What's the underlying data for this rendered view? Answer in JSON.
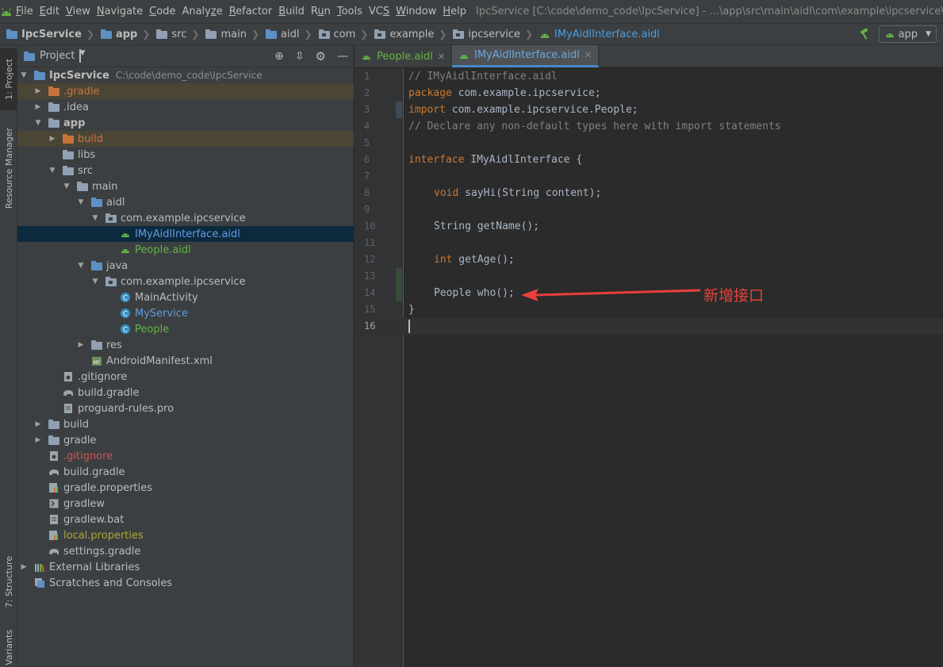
{
  "menu": {
    "items": [
      {
        "label": "File",
        "mnemonic": "F"
      },
      {
        "label": "Edit",
        "mnemonic": "E"
      },
      {
        "label": "View",
        "mnemonic": "V"
      },
      {
        "label": "Navigate",
        "mnemonic": "N"
      },
      {
        "label": "Code",
        "mnemonic": "C"
      },
      {
        "label": "Analyze",
        "mnemonic": "z"
      },
      {
        "label": "Refactor",
        "mnemonic": "R"
      },
      {
        "label": "Build",
        "mnemonic": "B"
      },
      {
        "label": "Run",
        "mnemonic": "u"
      },
      {
        "label": "Tools",
        "mnemonic": "T"
      },
      {
        "label": "VCS",
        "mnemonic": "S"
      },
      {
        "label": "Window",
        "mnemonic": "W"
      },
      {
        "label": "Help",
        "mnemonic": "H"
      }
    ],
    "window_title": "IpcService [C:\\code\\demo_code\\IpcService] - ...\\app\\src\\main\\aidl\\com\\example\\ipcservice\\IMyAidlInterface.aidl"
  },
  "breadcrumb": {
    "items": [
      "IpcService",
      "app",
      "src",
      "main",
      "aidl",
      "com",
      "example",
      "ipcservice",
      "IMyAidlInterface.aidl"
    ]
  },
  "run_config": {
    "label": "app"
  },
  "side_tabs": {
    "project": "1: Project",
    "resource_manager": "Resource Manager",
    "structure": "7: Structure",
    "variants": "Variants"
  },
  "project_panel": {
    "title": "Project",
    "root_path": "C:\\code\\demo_code\\IpcService",
    "tree": [
      {
        "label": "IpcService",
        "bold": true
      },
      {
        "label": ".gradle"
      },
      {
        "label": ".idea"
      },
      {
        "label": "app",
        "bold": true
      },
      {
        "label": "build"
      },
      {
        "label": "libs"
      },
      {
        "label": "src"
      },
      {
        "label": "main"
      },
      {
        "label": "aidl"
      },
      {
        "label": "com.example.ipcservice"
      },
      {
        "label": "IMyAidlInterface.aidl"
      },
      {
        "label": "People.aidl"
      },
      {
        "label": "java"
      },
      {
        "label": "com.example.ipcservice"
      },
      {
        "label": "MainActivity"
      },
      {
        "label": "MyService"
      },
      {
        "label": "People"
      },
      {
        "label": "res"
      },
      {
        "label": "AndroidManifest.xml"
      },
      {
        "label": ".gitignore"
      },
      {
        "label": "build.gradle"
      },
      {
        "label": "proguard-rules.pro"
      },
      {
        "label": "build"
      },
      {
        "label": "gradle"
      },
      {
        "label": ".gitignore"
      },
      {
        "label": "build.gradle"
      },
      {
        "label": "gradle.properties"
      },
      {
        "label": "gradlew"
      },
      {
        "label": "gradlew.bat"
      },
      {
        "label": "local.properties"
      },
      {
        "label": "settings.gradle"
      },
      {
        "label": "External Libraries"
      },
      {
        "label": "Scratches and Consoles"
      }
    ]
  },
  "editor": {
    "tabs": [
      {
        "label": "People.aidl",
        "active": false
      },
      {
        "label": "IMyAidlInterface.aidl",
        "active": true
      }
    ],
    "line_numbers": [
      "1",
      "2",
      "3",
      "4",
      "5",
      "6",
      "7",
      "8",
      "9",
      "10",
      "11",
      "12",
      "13",
      "14",
      "15",
      "16"
    ],
    "code": {
      "l1": "// IMyAidlInterface.aidl",
      "l2_kw": "package",
      "l2_rest": " com.example.ipcservice;",
      "l3_kw": "import",
      "l3_rest": " com.example.ipcservice.People;",
      "l4": "// Declare any non-default types here with import statements",
      "l6_kw": "interface",
      "l6_rest": " IMyAidlInterface {",
      "l8_kw": "void",
      "l8_rest": " sayHi(String content);",
      "l10": "String getName();",
      "l12_kw": "int",
      "l12_rest": " getAge();",
      "l14": "People who();",
      "l15": "}"
    }
  },
  "annotation": {
    "text": "新增接口",
    "color": "#e8403a"
  },
  "colors": {
    "accent": "#4a88c7",
    "android_green": "#62b543",
    "keyword": "#cc7832",
    "comment": "#808080"
  }
}
